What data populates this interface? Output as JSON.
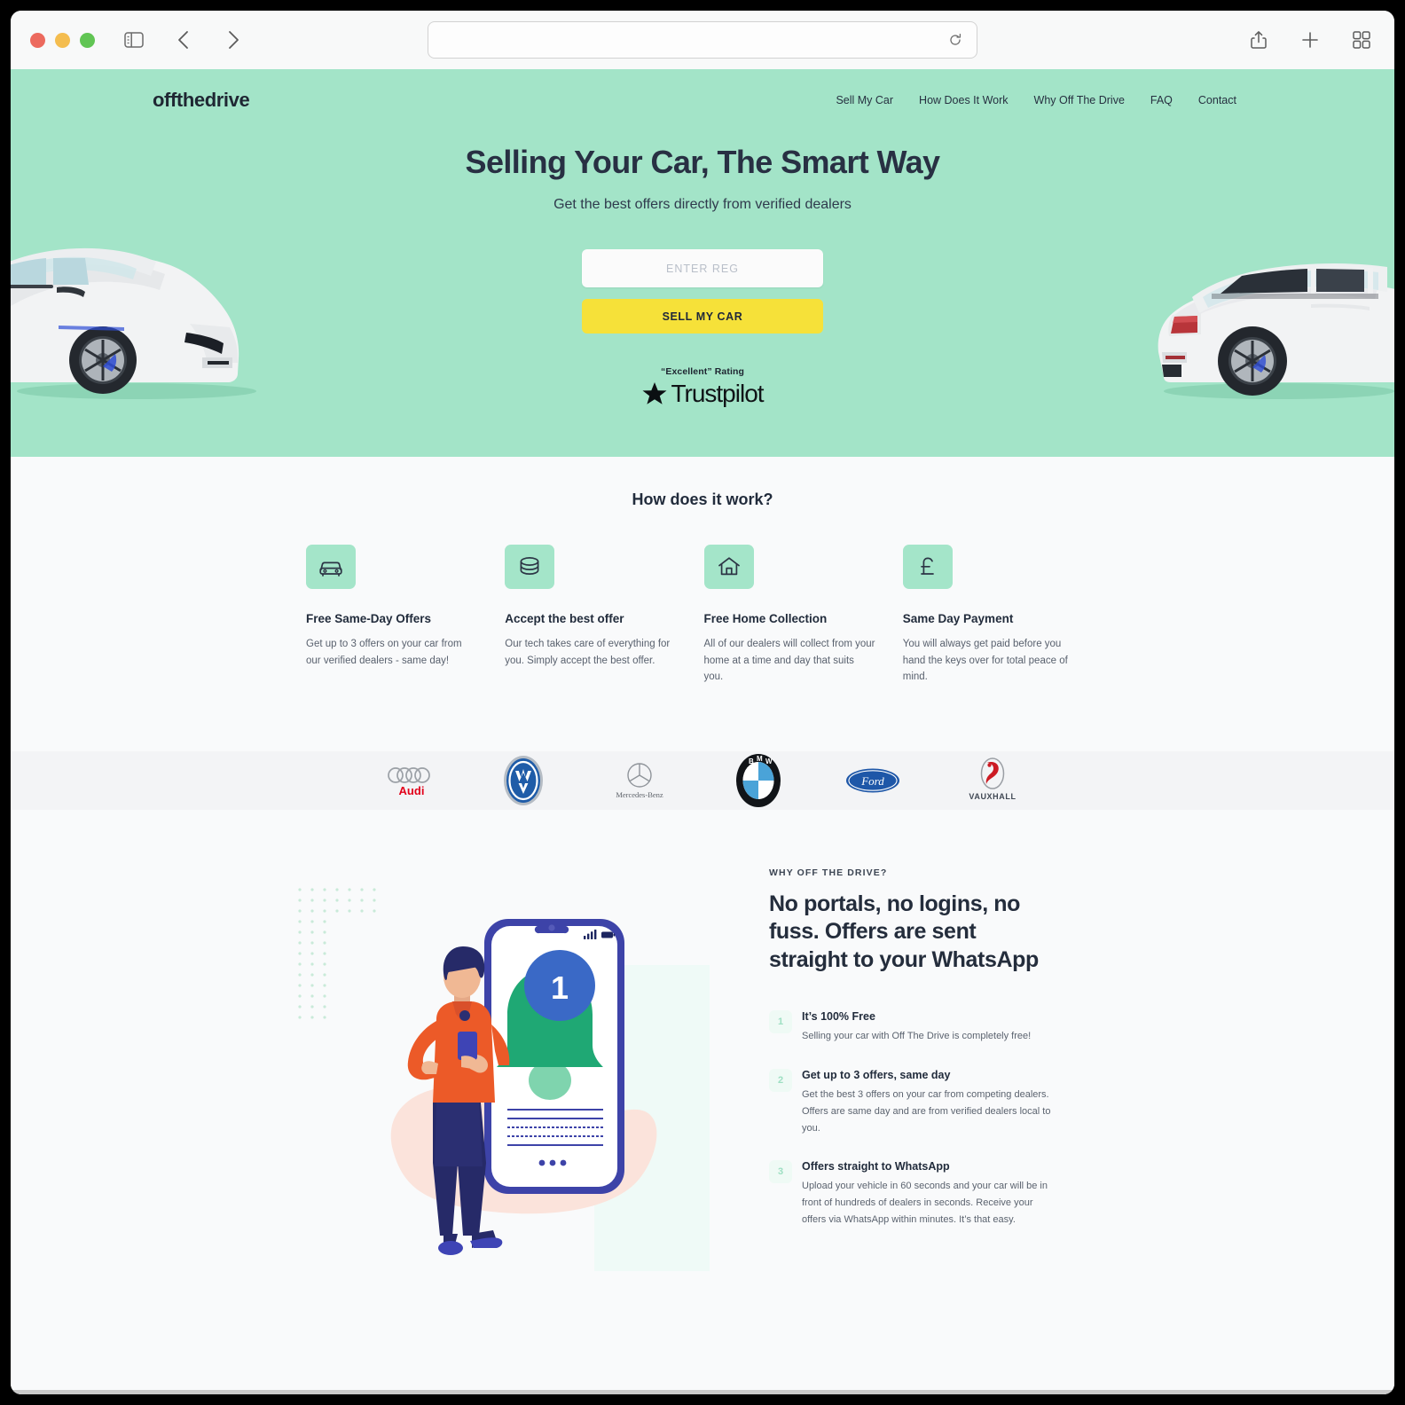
{
  "browser": {
    "url_value": "",
    "url_placeholder": "",
    "icons": {
      "sidebar": "sidebar-icon",
      "back": "back-chevron-icon",
      "forward": "forward-chevron-icon",
      "reload": "reload-icon",
      "share": "share-icon",
      "new_tab": "plus-icon",
      "tab_overview": "tab-overview-icon"
    }
  },
  "site": {
    "logo": "offthedrive",
    "nav": [
      {
        "label": "Sell My Car"
      },
      {
        "label": "How Does It Work"
      },
      {
        "label": "Why Off The Drive"
      },
      {
        "label": "FAQ"
      },
      {
        "label": "Contact"
      }
    ]
  },
  "hero": {
    "heading": "Selling Your Car, The Smart Way",
    "subheading": "Get the best offers directly from verified dealers",
    "reg_placeholder": "ENTER REG",
    "reg_value": "",
    "cta_label": "SELL MY CAR",
    "trust_label": "“Excellent” Rating",
    "trust_name": "Trustpilot",
    "background_color": "#a3e4c8",
    "cta_color": "#f6e139"
  },
  "how_it_works": {
    "title": "How does it work?",
    "items": [
      {
        "icon": "car-icon",
        "title": "Free Same-Day Offers",
        "text": "Get up to 3 offers on your car from our verified dealers - same day!"
      },
      {
        "icon": "coins-icon",
        "title": "Accept the best offer",
        "text": "Our tech takes care of everything for you. Simply accept the best offer."
      },
      {
        "icon": "home-icon",
        "title": "Free Home Collection",
        "text": "All of our dealers will collect from your home at a time and day that suits you."
      },
      {
        "icon": "pound-icon",
        "title": "Same Day Payment",
        "text": "You will always get paid before you hand the keys over for total peace of mind."
      }
    ]
  },
  "brands": [
    {
      "name": "Audi",
      "icon": "audi-logo"
    },
    {
      "name": "Volkswagen",
      "icon": "volkswagen-logo"
    },
    {
      "name": "Mercedes-Benz",
      "icon": "mercedes-benz-logo"
    },
    {
      "name": "BMW",
      "icon": "bmw-logo"
    },
    {
      "name": "Ford",
      "icon": "ford-logo"
    },
    {
      "name": "VAUXHALL",
      "icon": "vauxhall-logo"
    }
  ],
  "why": {
    "eyebrow": "WHY OFF THE DRIVE?",
    "heading": "No portals, no logins, no fuss. Offers are sent straight to your WhatsApp",
    "illustration": {
      "notification_badge": "1",
      "alt": "person-with-phone-notification-illustration"
    },
    "steps": [
      {
        "num": "1",
        "title": "It’s 100% Free",
        "text": "Selling your car with Off The Drive is completely free!"
      },
      {
        "num": "2",
        "title": "Get up to 3 offers, same day",
        "text": "Get the best 3 offers on your car from competing dealers. Offers are same day and are from verified dealers local to you."
      },
      {
        "num": "3",
        "title": "Offers straight to WhatsApp",
        "text": "Upload your vehicle in 60 seconds and your car will be in front of hundreds of dealers in seconds. Receive your offers via WhatsApp within minutes. It’s that easy."
      }
    ]
  }
}
